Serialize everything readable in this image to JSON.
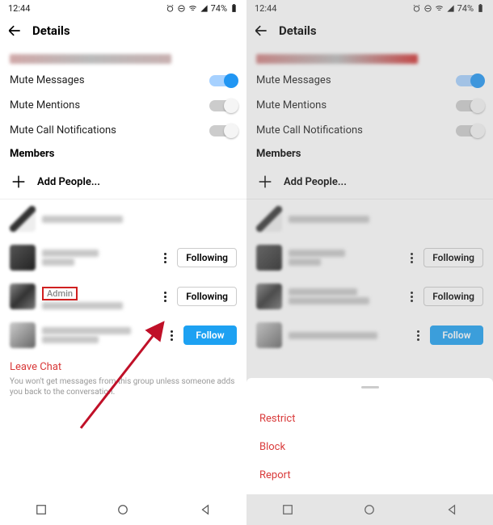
{
  "status": {
    "time": "12:44",
    "battery": "74%"
  },
  "header": {
    "title": "Details"
  },
  "settings": {
    "mute_messages": {
      "label": "Mute Messages",
      "on": true
    },
    "mute_mentions": {
      "label": "Mute Mentions",
      "on": false
    },
    "mute_calls": {
      "label": "Mute Call Notifications",
      "on": false
    }
  },
  "members_label": "Members",
  "add_people_label": "Add People...",
  "admin_badge": "Admin",
  "buttons": {
    "following": "Following",
    "follow": "Follow"
  },
  "leave_label": "Leave Chat",
  "leave_hint": "You won't get messages from this group unless someone adds you back to the conversation.",
  "sheet": {
    "restrict": "Restrict",
    "block": "Block",
    "report": "Report"
  }
}
